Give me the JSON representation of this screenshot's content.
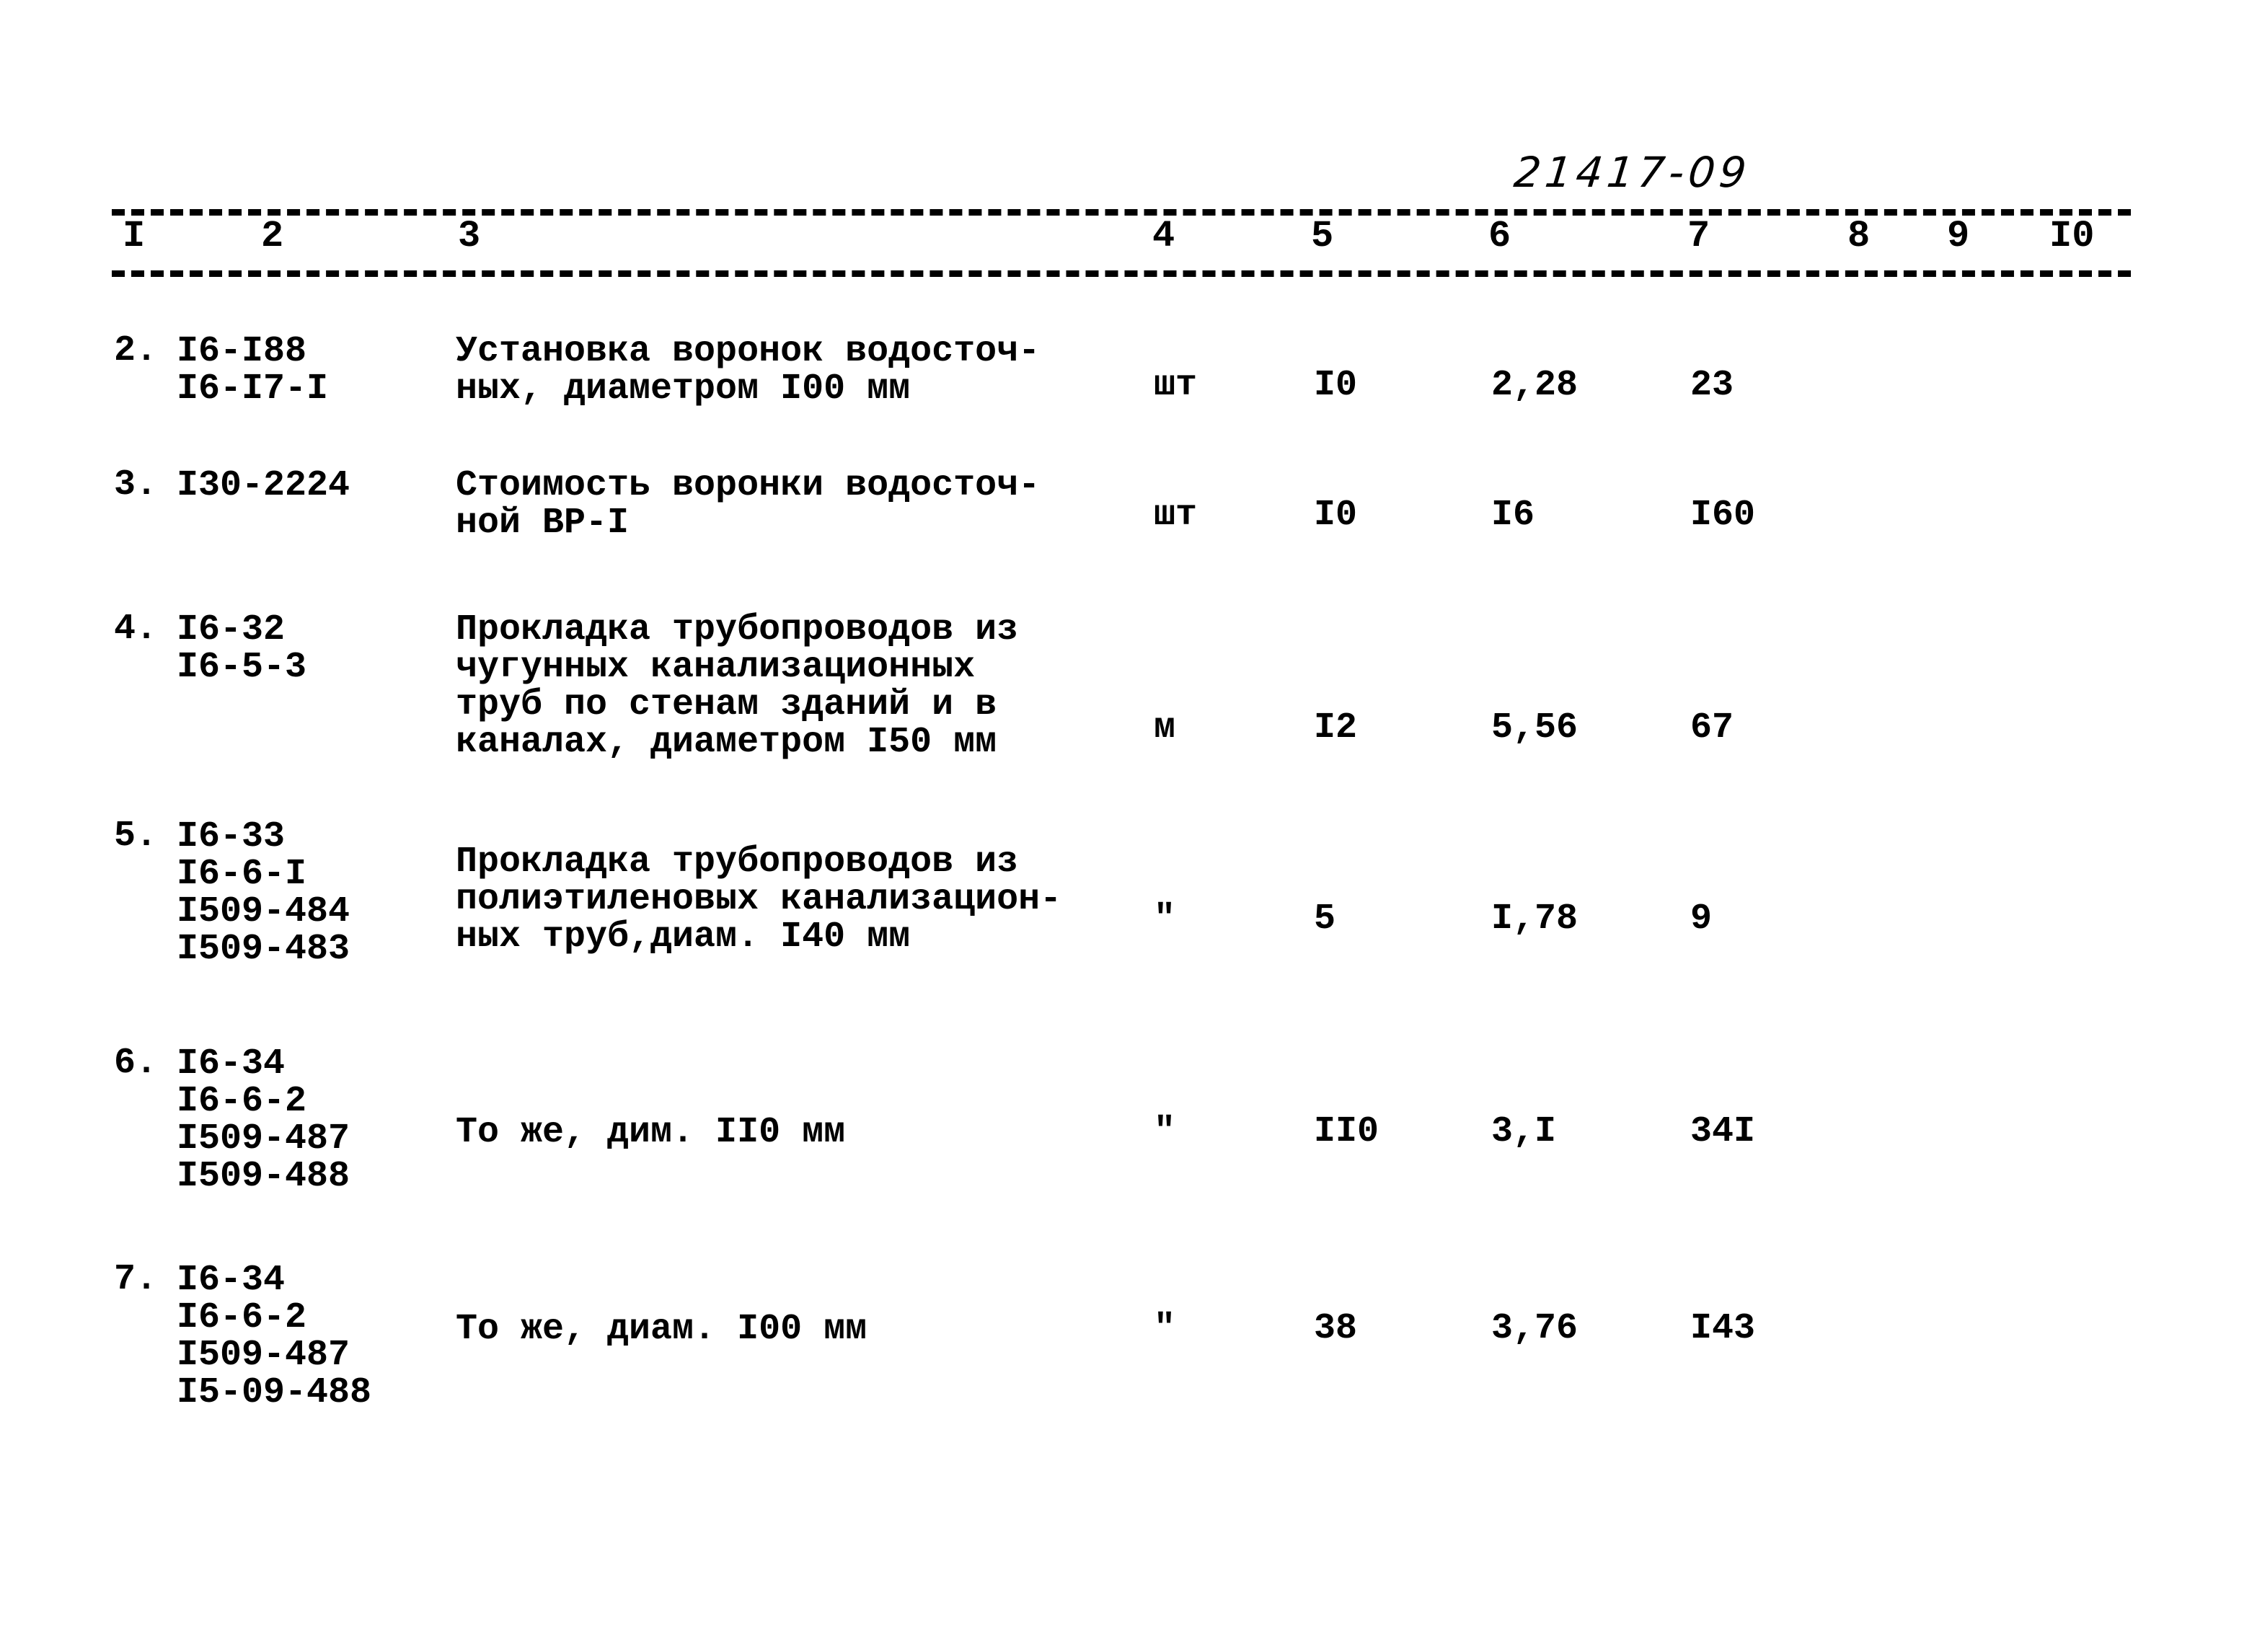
{
  "document": {
    "number": "21417-09",
    "columns": [
      "I",
      "2",
      "3",
      "4",
      "5",
      "6",
      "7",
      "8",
      "9",
      "I0"
    ],
    "rows": [
      {
        "index": "2.",
        "codes": [
          "I6-I88",
          "I6-I7-I"
        ],
        "description": [
          "Установка воронок водосточ-",
          "ных, диаметром I00 мм"
        ],
        "unit": "шт",
        "quantity": "I0",
        "unit_price": "2,28",
        "total": "23"
      },
      {
        "index": "3.",
        "codes": [
          "I30-2224"
        ],
        "description": [
          "Стоимость воронки водосточ-",
          "ной ВР-I"
        ],
        "unit": "шт",
        "quantity": "I0",
        "unit_price": "I6",
        "total": "I60"
      },
      {
        "index": "4.",
        "codes": [
          "I6-32",
          "I6-5-3"
        ],
        "description": [
          "Прокладка трубопроводов из",
          "чугунных канализационных",
          "труб по стенам зданий и в",
          "каналах, диаметром I50 мм"
        ],
        "unit": "м",
        "quantity": "I2",
        "unit_price": "5,56",
        "total": "67"
      },
      {
        "index": "5.",
        "codes": [
          "I6-33",
          "I6-6-I",
          "I509-484",
          "I509-483"
        ],
        "description": [
          "Прокладка трубопроводов из",
          "полиэтиленовых канализацион-",
          "ных труб,диам. I40 мм"
        ],
        "unit": "\"",
        "quantity": "5",
        "unit_price": "I,78",
        "total": "9"
      },
      {
        "index": "6.",
        "codes": [
          "I6-34",
          "I6-6-2",
          "I509-487",
          "I509-488"
        ],
        "description": [
          "То же, дим. II0 мм"
        ],
        "unit": "\"",
        "quantity": "II0",
        "unit_price": "3,I",
        "total": "34I"
      },
      {
        "index": "7.",
        "codes": [
          "I6-34",
          "I6-6-2",
          "I509-487",
          "I5-09-488"
        ],
        "description": [
          "То же, диам. I00 мм"
        ],
        "unit": "\"",
        "quantity": "38",
        "unit_price": "3,76",
        "total": "I43"
      }
    ]
  }
}
